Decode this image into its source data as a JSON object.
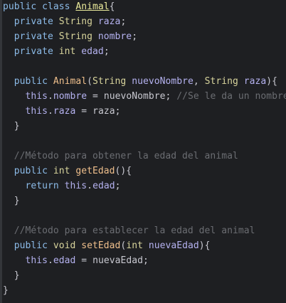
{
  "editor": {
    "language": "Java",
    "colors": {
      "background": "#1e1f22",
      "keyword": "#8cbbe8",
      "type": "#d8d49c",
      "comment": "#6b6d72"
    },
    "lines": [
      [
        [
          "public class ",
          "kw"
        ],
        [
          "Animal",
          "ul"
        ],
        [
          "{",
          "p"
        ]
      ],
      [
        [
          "  private ",
          "kw"
        ],
        [
          "String ",
          "type"
        ],
        [
          "raza",
          "var"
        ],
        [
          ";",
          "p"
        ]
      ],
      [
        [
          "  private ",
          "kw"
        ],
        [
          "String ",
          "type"
        ],
        [
          "nombre",
          "var"
        ],
        [
          ";",
          "p"
        ]
      ],
      [
        [
          "  private ",
          "kw"
        ],
        [
          "int ",
          "type"
        ],
        [
          "edad",
          "var"
        ],
        [
          ";",
          "p"
        ]
      ],
      [],
      [
        [
          "  public ",
          "kw"
        ],
        [
          "Animal",
          "cls"
        ],
        [
          "(",
          "p"
        ],
        [
          "String ",
          "type"
        ],
        [
          "nuevoNombre",
          "var"
        ],
        [
          ", ",
          "p"
        ],
        [
          "String ",
          "type"
        ],
        [
          "raza",
          "var"
        ],
        [
          "){",
          "p"
        ]
      ],
      [
        [
          "    this",
          "this"
        ],
        [
          ".",
          "p"
        ],
        [
          "nombre",
          "var"
        ],
        [
          " = ",
          "p"
        ],
        [
          "nuevoNombre",
          "p"
        ],
        [
          "; ",
          "p"
        ],
        [
          "//Se le da un nombre",
          "cm"
        ]
      ],
      [
        [
          "    this",
          "this"
        ],
        [
          ".",
          "p"
        ],
        [
          "raza",
          "var"
        ],
        [
          " = ",
          "p"
        ],
        [
          "raza",
          "p"
        ],
        [
          ";",
          "p"
        ]
      ],
      [
        [
          "  }",
          "p"
        ]
      ],
      [],
      [
        [
          "  //Método para obtener la edad del animal",
          "cm"
        ]
      ],
      [
        [
          "  public ",
          "kw"
        ],
        [
          "int ",
          "type"
        ],
        [
          "getEdad",
          "fn"
        ],
        [
          "(){",
          "p"
        ]
      ],
      [
        [
          "    return ",
          "kw"
        ],
        [
          "this",
          "this"
        ],
        [
          ".",
          "p"
        ],
        [
          "edad",
          "var"
        ],
        [
          ";",
          "p"
        ]
      ],
      [
        [
          "  }",
          "p"
        ]
      ],
      [],
      [
        [
          "  //Método para establecer la edad del animal",
          "cm"
        ]
      ],
      [
        [
          "  public ",
          "kw"
        ],
        [
          "void ",
          "type"
        ],
        [
          "setEdad",
          "fn"
        ],
        [
          "(",
          "p"
        ],
        [
          "int ",
          "type"
        ],
        [
          "nuevaEdad",
          "var"
        ],
        [
          "){",
          "p"
        ]
      ],
      [
        [
          "    this",
          "this"
        ],
        [
          ".",
          "p"
        ],
        [
          "edad",
          "var"
        ],
        [
          " = ",
          "p"
        ],
        [
          "nuevaEdad",
          "p"
        ],
        [
          ";",
          "p"
        ]
      ],
      [
        [
          "  }",
          "p"
        ]
      ],
      [
        [
          "}",
          "p"
        ]
      ]
    ]
  }
}
